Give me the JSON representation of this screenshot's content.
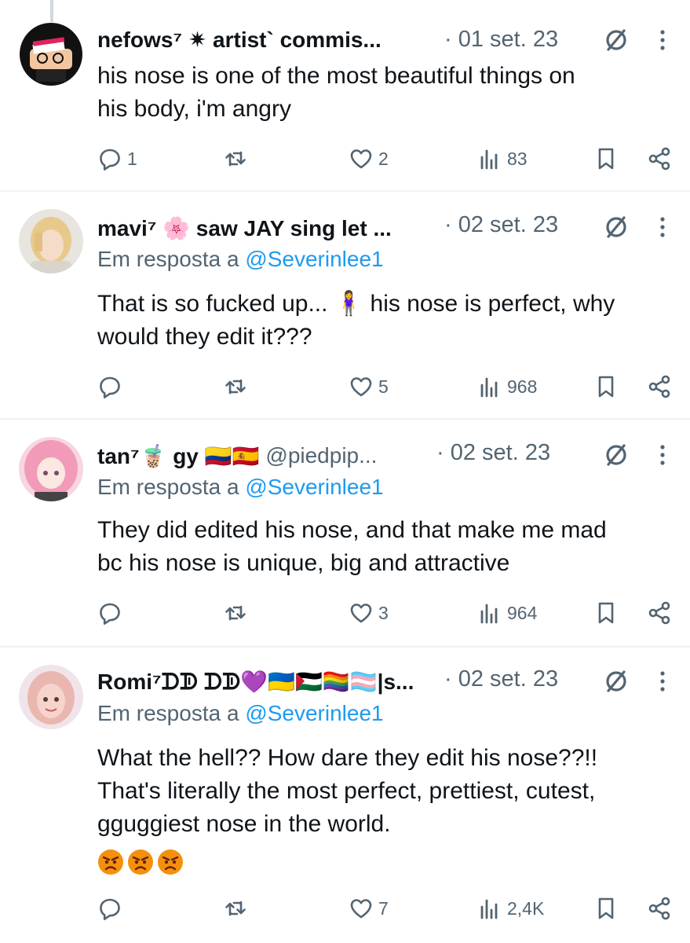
{
  "tweets": [
    {
      "name": "nefows⁷ ✷ artist` commis...",
      "name_extra": "",
      "date": "· 01 set. 23",
      "replying_prefix": "",
      "replying_handle": "",
      "text": [
        "his nose is one of the most beautiful things on",
        "his body, i'm angry"
      ],
      "replies": "1",
      "reposts": "",
      "likes": "2",
      "views": "83"
    },
    {
      "name": "mavi⁷ 🌸 saw JAY sing let ...",
      "name_extra": "",
      "date": "· 02 set. 23",
      "replying_prefix": "Em resposta a ",
      "replying_handle": "@Severinlee1",
      "text": [
        "That is so fucked up... 🧍‍♀️ his nose is perfect, why",
        "would they edit it???"
      ],
      "replies": "",
      "reposts": "",
      "likes": "5",
      "views": "968"
    },
    {
      "name": "tan⁷🧋 gy 🇨🇴🇪🇸",
      "name_extra": "@piedpip...",
      "date": "· 02 set. 23",
      "replying_prefix": "Em resposta a ",
      "replying_handle": "@Severinlee1",
      "text": [
        "They did edited his nose, and that make me mad",
        "bc his nose is unique, big and attractive"
      ],
      "replies": "",
      "reposts": "",
      "likes": "3",
      "views": "964"
    },
    {
      "name": "Romi⁷ᗪᗫ ᗪᗫ💜🇺🇦🇵🇸🏳️‍🌈🏳️‍⚧️|s...",
      "name_extra": "",
      "date": "· 02 set. 23",
      "replying_prefix": "Em resposta a ",
      "replying_handle": "@Severinlee1",
      "text": [
        "What the hell?? How dare they edit his nose??!!",
        "That's literally the most perfect, prettiest, cutest,",
        "gguggiest nose in the world."
      ],
      "replies": "",
      "reposts": "",
      "likes": "7",
      "views": "2,4K"
    }
  ],
  "icons": {
    "reply": "reply-icon",
    "repost": "repost-icon",
    "like": "heart-icon",
    "views": "views-icon",
    "bookmark": "bookmark-icon",
    "share": "share-icon",
    "grok": "grok-icon",
    "more": "more-icon"
  },
  "colors": {
    "text": "#0f1419",
    "secondary": "#536471",
    "link": "#1d9bf0",
    "divider": "#eff3f4"
  }
}
